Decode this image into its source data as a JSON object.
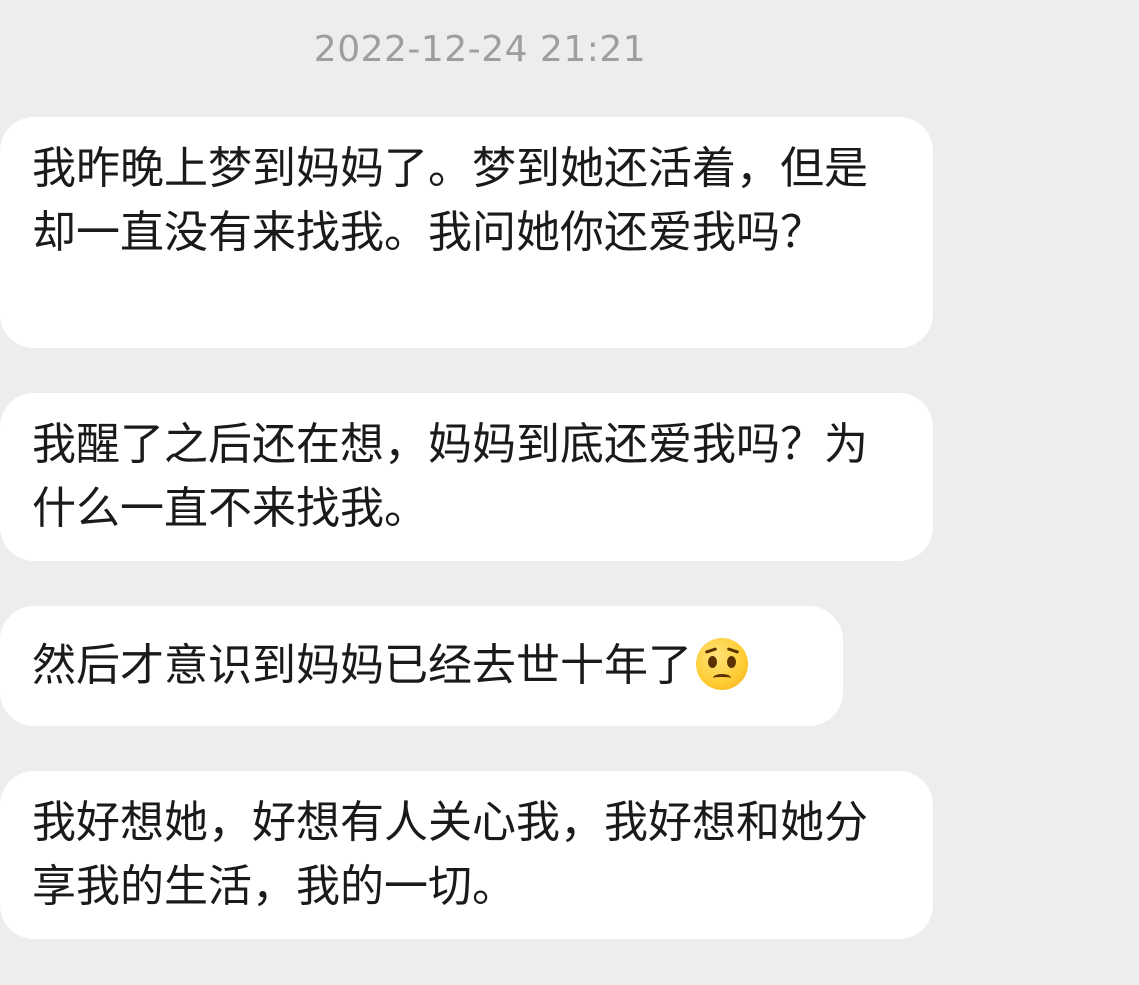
{
  "chat": {
    "timestamp": "2022-12-24 21:21",
    "messages": [
      {
        "text": "我昨晚上梦到妈妈了。梦到她还活着，但是却一直没有来找我。我问她你还爱我吗？"
      },
      {
        "text": "我醒了之后还在想，妈妈到底还爱我吗？为什么一直不来找我。"
      },
      {
        "text": "然后才意识到妈妈已经去世十年了",
        "emoji": "pleading-face-icon"
      },
      {
        "text": "我好想她，好想有人关心我，我好想和她分享我的生活，我的一切。"
      }
    ]
  },
  "colors": {
    "background": "#ededed",
    "bubble": "#ffffff",
    "text": "#1a1a1a",
    "timestamp": "#9e9e9e"
  }
}
